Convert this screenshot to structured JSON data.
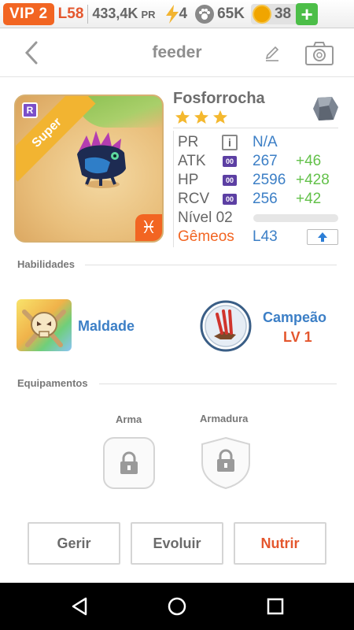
{
  "status_bar": {
    "vip": "VIP 2",
    "level": "L58",
    "pr_value": "433,4K",
    "pr_unit": "PR",
    "energy": "4",
    "paw": "65K",
    "coins": "38",
    "plus": "+"
  },
  "header": {
    "title": "feeder"
  },
  "pet": {
    "name": "Fosforrocha",
    "rarity": "Super",
    "rarity_badge": "R",
    "stars": 3,
    "zodiac_symbol": "♓",
    "stats": [
      {
        "label": "PR",
        "icon": "i",
        "value": "N/A",
        "bonus": ""
      },
      {
        "label": "ATK",
        "icon": "00",
        "value": "267",
        "bonus": "+46"
      },
      {
        "label": "HP",
        "icon": "00",
        "value": "2596",
        "bonus": "+428"
      },
      {
        "label": "RCV",
        "icon": "00",
        "value": "256",
        "bonus": "+42"
      }
    ],
    "level_label": "Nível 02",
    "level_progress": 0,
    "zodiac_label": "Gêmeos",
    "zodiac_level": "L43"
  },
  "sections": {
    "abilities_title": "Habilidades",
    "equipment_title": "Equipamentos"
  },
  "abilities": {
    "left_name": "Maldade",
    "right_name": "Campeão",
    "right_level": "LV 1"
  },
  "equipment": {
    "weapon_label": "Arma",
    "armor_label": "Armadura"
  },
  "actions": {
    "manage": "Gerir",
    "evolve": "Evoluir",
    "feed": "Nutrir"
  },
  "colors": {
    "accent_orange": "#f26522",
    "blue_value": "#3c7fc6",
    "green_bonus": "#63c14a"
  }
}
